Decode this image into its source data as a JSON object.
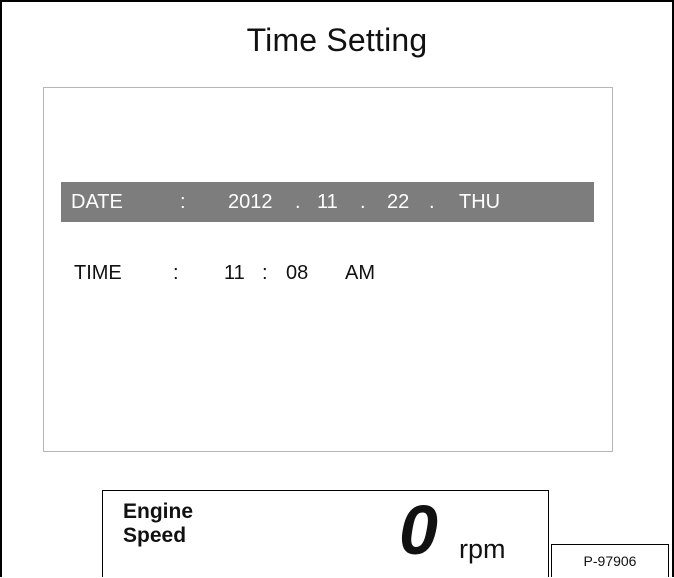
{
  "screen": {
    "title": "Time Setting"
  },
  "settings": {
    "date": {
      "label": "DATE",
      "separator": ":",
      "year": "2012",
      "dot1": ".",
      "month": "11",
      "dot2": ".",
      "day": "22",
      "dot3": ".",
      "weekday": "THU",
      "selected": true
    },
    "time": {
      "label": "TIME",
      "separator": ":",
      "hour": "11",
      "colon": ":",
      "minute": "08",
      "meridiem": "AM"
    }
  },
  "status": {
    "engine_label_line1": "Engine",
    "engine_label_line2": "Speed",
    "engine_speed_value": "0",
    "engine_speed_unit": "rpm"
  },
  "reference": {
    "code": "P-97906"
  },
  "colors": {
    "selection_background": "#7d7d7d",
    "selection_text": "#ffffff",
    "panel_border": "#b5b5b5"
  }
}
